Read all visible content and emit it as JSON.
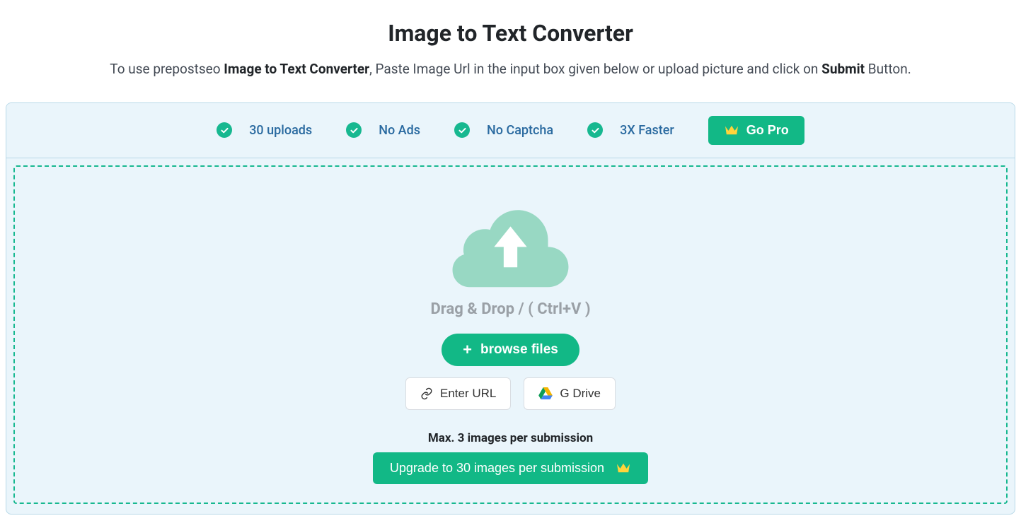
{
  "header": {
    "title": "Image to Text Converter",
    "subtitle_pre": "To use prepostseo ",
    "subtitle_bold1": "Image to Text Converter",
    "subtitle_mid": ", Paste Image Url in the input box given below or upload picture and click on ",
    "subtitle_bold2": "Submit",
    "subtitle_post": " Button."
  },
  "features": {
    "items": [
      {
        "label": "30 uploads"
      },
      {
        "label": "No Ads"
      },
      {
        "label": "No Captcha"
      },
      {
        "label": "3X Faster"
      }
    ],
    "go_pro_label": "Go Pro"
  },
  "dropzone": {
    "drag_text": "Drag & Drop / ( Ctrl+V )",
    "browse_label": "browse files",
    "enter_url_label": "Enter URL",
    "gdrive_label": "G Drive",
    "max_text": "Max. 3 images per submission",
    "upgrade_label": "Upgrade to 30 images per submission"
  }
}
